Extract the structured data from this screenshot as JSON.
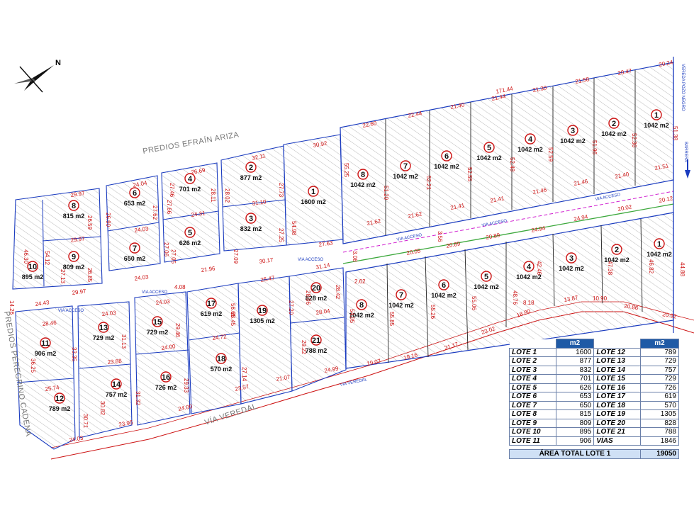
{
  "north_label": "N",
  "roads": {
    "predios_efrain": "PREDIOS EFRAÍN ARIZA",
    "predios_peregrino": "PREDIOS PEREGRINO CADENA",
    "via_veredal": "VÍA VEREDAL",
    "via_veredal_small": "VIA VEREDAL",
    "via_acceso": "VIA ACCESO",
    "vereda_pozo": "VEREDA POZO NEGRO",
    "barrera": "BARRERA"
  },
  "lots": [
    {
      "num": "1",
      "area": "1042 m2"
    },
    {
      "num": "2",
      "area": "1042 m2"
    },
    {
      "num": "3",
      "area": "1042 m2"
    },
    {
      "num": "4",
      "area": "1042 m2"
    },
    {
      "num": "5",
      "area": "1042 m2"
    },
    {
      "num": "6",
      "area": "1042 m2"
    },
    {
      "num": "7",
      "area": "1042 m2"
    },
    {
      "num": "8",
      "area": "1042 m2"
    },
    {
      "num": "1",
      "area": "1042 m2"
    },
    {
      "num": "2",
      "area": "1042 m2"
    },
    {
      "num": "3",
      "area": "1042 m2"
    },
    {
      "num": "4",
      "area": "1042 m2"
    },
    {
      "num": "5",
      "area": "1042 m2"
    },
    {
      "num": "6",
      "area": "1042 m2"
    },
    {
      "num": "7",
      "area": "1042 m2"
    },
    {
      "num": "8",
      "area": "1042 m2"
    },
    {
      "num": "1",
      "area": "1600 m2"
    },
    {
      "num": "2",
      "area": "877 m2"
    },
    {
      "num": "3",
      "area": "832 m2"
    },
    {
      "num": "4",
      "area": "701 m2"
    },
    {
      "num": "5",
      "area": "626 m2"
    },
    {
      "num": "6",
      "area": "653 m2"
    },
    {
      "num": "7",
      "area": "650 m2"
    },
    {
      "num": "8",
      "area": "815 m2"
    },
    {
      "num": "9",
      "area": "809 m2"
    },
    {
      "num": "10",
      "area": "895 m2"
    },
    {
      "num": "11",
      "area": "906 m2"
    },
    {
      "num": "12",
      "area": "789 m2"
    },
    {
      "num": "13",
      "area": "729 m2"
    },
    {
      "num": "14",
      "area": "757 m2"
    },
    {
      "num": "15",
      "area": "729 m2"
    },
    {
      "num": "16",
      "area": "726 m2"
    },
    {
      "num": "17",
      "area": "619 m2"
    },
    {
      "num": "18",
      "area": "570 m2"
    },
    {
      "num": "19",
      "area": "1305 m2"
    },
    {
      "num": "20",
      "area": "828 m2"
    },
    {
      "num": "21",
      "area": "788 m2"
    }
  ],
  "dimensions": [
    "171.44",
    "20.24",
    "20.47",
    "21.58",
    "21.30",
    "21.44",
    "21.40",
    "22.44",
    "22.60",
    "21.51",
    "21.40",
    "21.46",
    "21.46",
    "21.41",
    "21.41",
    "21.62",
    "21.62",
    "20.12",
    "20.02",
    "24.94",
    "24.94",
    "20.89",
    "20.89",
    "20.05",
    "18.80",
    "13.87",
    "10.90",
    "20.86",
    "20.92",
    "23.02",
    "21.17",
    "19.16",
    "19.07",
    "51.38",
    "52.36",
    "51.96",
    "52.59",
    "52.48",
    "52.55",
    "52.21",
    "51.20",
    "55.25",
    "30.92",
    "32.11",
    "26.69",
    "24.04",
    "29.97",
    "27.63",
    "31.10",
    "24.31",
    "24.03",
    "29.97",
    "30.17",
    "21.96",
    "24.03",
    "29.97",
    "24.43",
    "31.14",
    "25.47",
    "28.04",
    "24.99",
    "21.07",
    "23.57",
    "24.00",
    "23.95",
    "24.03",
    "25.74",
    "28.46",
    "24.03",
    "24.03",
    "24.72",
    "24.00",
    "23.88",
    "31.13",
    "29.46",
    "28.45",
    "27.14",
    "29.33",
    "31.32",
    "30.82",
    "30.71",
    "36.25",
    "33.35",
    "54.12",
    "46.30",
    "14.26",
    "27.13",
    "26.85",
    "26.90",
    "26.59",
    "27.66",
    "27.62",
    "27.46",
    "28.11",
    "27.05",
    "27.06",
    "28.02",
    "27.73",
    "27.09",
    "27.25",
    "54.98",
    "56.65",
    "27.20",
    "29.22",
    "28.06",
    "28.42",
    "54.95",
    "55.85",
    "55.26",
    "55.06",
    "48.76",
    "42.46",
    "47.38",
    "46.82",
    "44.88",
    "4.08",
    "8.18",
    "3.56",
    "3.08",
    "2.62"
  ],
  "table": {
    "header": "m2",
    "rows": [
      [
        "LOTE 1",
        "1600",
        "LOTE 12",
        "789"
      ],
      [
        "LOTE 2",
        "877",
        "LOTE 13",
        "729"
      ],
      [
        "LOTE 3",
        "832",
        "LOTE 14",
        "757"
      ],
      [
        "LOTE 4",
        "701",
        "LOTE 15",
        "729"
      ],
      [
        "LOTE 5",
        "626",
        "LOTE 16",
        "726"
      ],
      [
        "LOTE 6",
        "653",
        "LOTE 17",
        "619"
      ],
      [
        "LOTE 7",
        "650",
        "LOTE 18",
        "570"
      ],
      [
        "LOTE 8",
        "815",
        "LOTE 19",
        "1305"
      ],
      [
        "LOTE 9",
        "809",
        "LOTE 20",
        "828"
      ],
      [
        "LOTE 10",
        "895",
        "LOTE 21",
        "788"
      ],
      [
        "LOTE 11",
        "906",
        "VÍAS",
        "1846"
      ]
    ],
    "total_label": "ÁREA TOTAL LOTE 1",
    "total_value": "19050"
  },
  "colors": {
    "boundary": "#1a3bbf",
    "dims": "#cc1111",
    "hatch": "#9a9a9a",
    "road_pink": "#d020d0",
    "road_green": "#3ca83c",
    "table_header": "#1f5aa6"
  }
}
